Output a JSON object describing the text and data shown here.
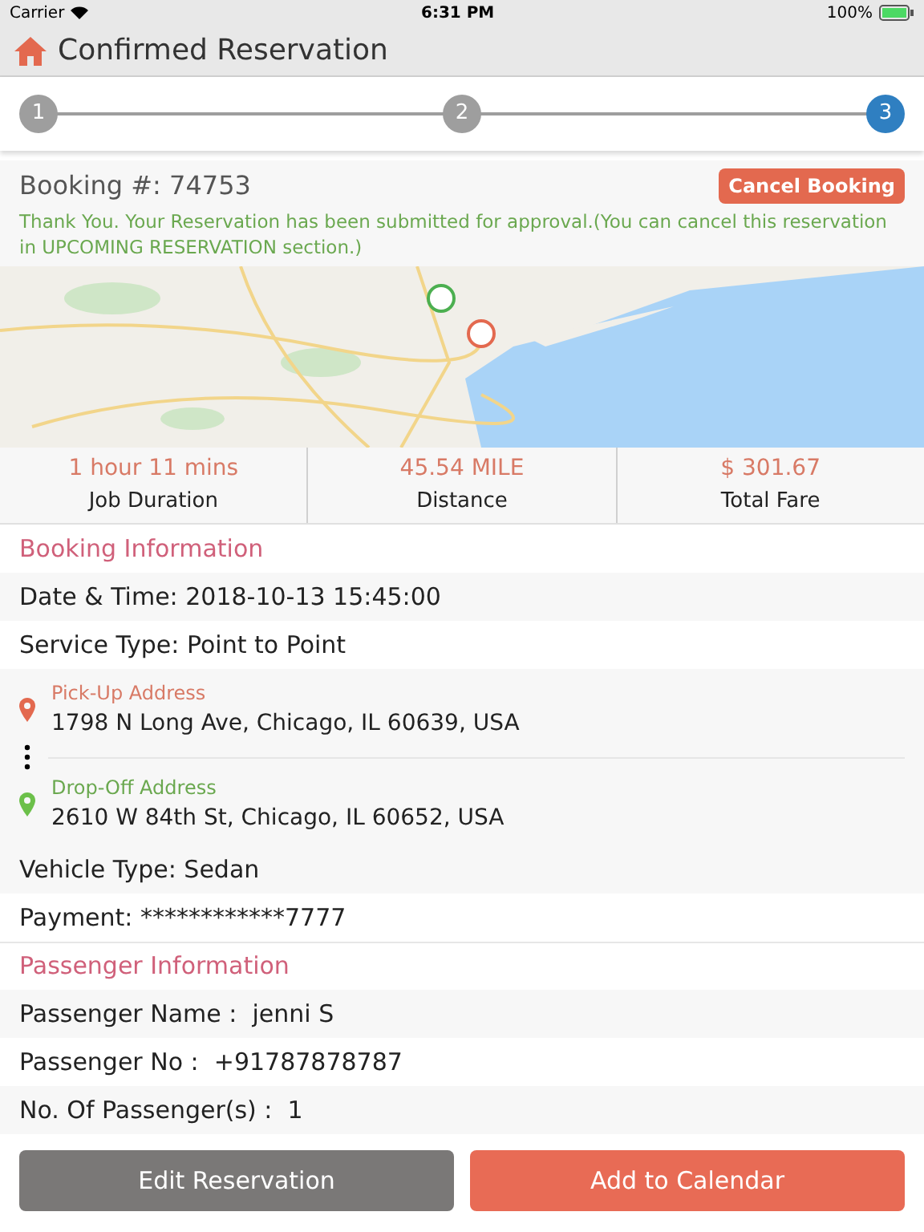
{
  "status_bar": {
    "carrier": "Carrier",
    "time": "6:31 PM",
    "battery": "100%"
  },
  "header": {
    "title": "Confirmed Reservation"
  },
  "steps": [
    {
      "label": "1",
      "selected": false
    },
    {
      "label": "2",
      "selected": false
    },
    {
      "label": "3",
      "selected": true
    }
  ],
  "booking": {
    "number": "Booking #: 74753",
    "cancel_button": "Cancel Booking",
    "message": "Thank You. Your Reservation has been submitted for approval.(You can cancel this reservation in UPCOMING RESERVATION section.)"
  },
  "stats": [
    {
      "value": "1 hour 11 mins",
      "label": "Job Duration"
    },
    {
      "value": "45.54 MILE",
      "label": "Distance"
    },
    {
      "value": "$ 301.67",
      "label": "Total Fare"
    }
  ],
  "booking_information": {
    "heading": "Booking Information",
    "rows": [
      "Date & Time: 2018-10-13 15:45:00",
      "Service Type: Point to Point"
    ],
    "addresses": [
      {
        "kind": "pickup",
        "label": "Pick-Up Address",
        "value": "1798 N Long Ave, Chicago, IL 60639, USA"
      },
      {
        "kind": "dropoff",
        "label": "Drop-Off Address",
        "value": "2610 W 84th St, Chicago, IL 60652, USA"
      }
    ],
    "rows_after": [
      "Vehicle Type: Sedan",
      "Payment: ************7777"
    ]
  },
  "passenger_information": {
    "heading": "Passenger Information",
    "rows": [
      "Passenger Name :  jenni S",
      "Passenger No :  +91787878787",
      "No. Of Passenger(s) :  1"
    ]
  },
  "buttons": [
    {
      "kind": "secondary",
      "label": "Edit Reservation"
    },
    {
      "kind": "primary",
      "label": "Add to Calendar"
    }
  ]
}
